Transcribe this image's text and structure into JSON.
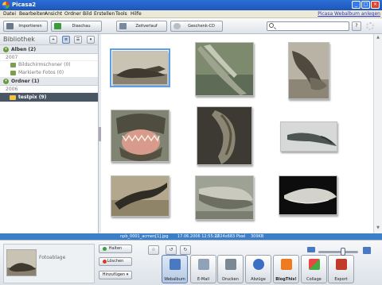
{
  "window": {
    "title": "Picasa2"
  },
  "menu": {
    "items": [
      "Datei",
      "Bearbeiten",
      "Ansicht",
      "Ordner",
      "Bild",
      "Erstellen",
      "Tools",
      "Hilfe"
    ],
    "weblink": "Picasa Webalbum anlegen"
  },
  "toolbar": {
    "import": "Importieren",
    "slideshow": "Diaschau",
    "timeline": "Zeitverlauf",
    "giftcd": "Geschenk-CD",
    "search_value": ""
  },
  "sidebar": {
    "title": "Bibliothek",
    "albums_header": "Alben (2)",
    "albums_year": "2007",
    "albums": [
      "Bildschirmschoner (0)",
      "Markierte Fotos (0)"
    ],
    "folders_header": "Ordner (1)",
    "folders_year": "2006",
    "selected_folder": "testpix (9)"
  },
  "status": {
    "filename": "npb_0001_acmen[1].jpg",
    "date": "17.06.2006 12:55:22",
    "dimensions": "1024x683 Pixel",
    "size": "309KB"
  },
  "bottom": {
    "tray_label": "Fotoablage",
    "hold": "Halten",
    "clear": "Löschen",
    "add_to": "Hinzufügen",
    "export_buttons": [
      "Webalbum",
      "E-Mail",
      "Drucken",
      "Abzüge",
      "BlogThis!",
      "Collage",
      "Export"
    ]
  },
  "colors": {
    "titlebar": "#1f56b8",
    "statusbar": "#3d7fc7",
    "selection": "#5aa0e6",
    "folder_selected": "#4a5564"
  }
}
